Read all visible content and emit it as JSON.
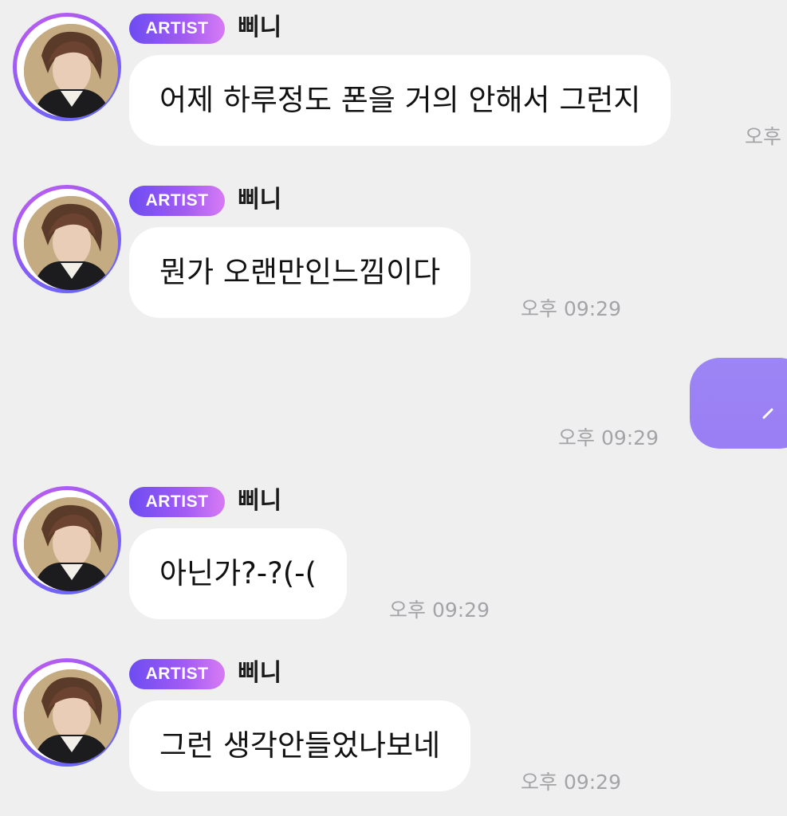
{
  "colors": {
    "background": "#efeff0",
    "bubble_received": "#ffffff",
    "bubble_sent": "#9c85f5",
    "artist_badge_gradient_start": "#6d4cf2",
    "artist_badge_gradient_end": "#d77bf4",
    "timestamp_text": "#a4a4a8"
  },
  "messages": [
    {
      "sender_badge": "ARTIST",
      "sender_name": "삐니",
      "text": "어제 하루정도 폰을 거의 안해서 그런지",
      "time": "오후"
    },
    {
      "sender_badge": "ARTIST",
      "sender_name": "삐니",
      "text": "뭔가 오랜만인느낌이다",
      "time": "오후 09:29"
    },
    {
      "sent": true,
      "text": "",
      "time": "오후 09:29"
    },
    {
      "sender_badge": "ARTIST",
      "sender_name": "삐니",
      "text": "아닌가?-?(-(",
      "time": "오후 09:29"
    },
    {
      "sender_badge": "ARTIST",
      "sender_name": "삐니",
      "text": "그런 생각안들었나보네",
      "time": "오후 09:29"
    }
  ]
}
